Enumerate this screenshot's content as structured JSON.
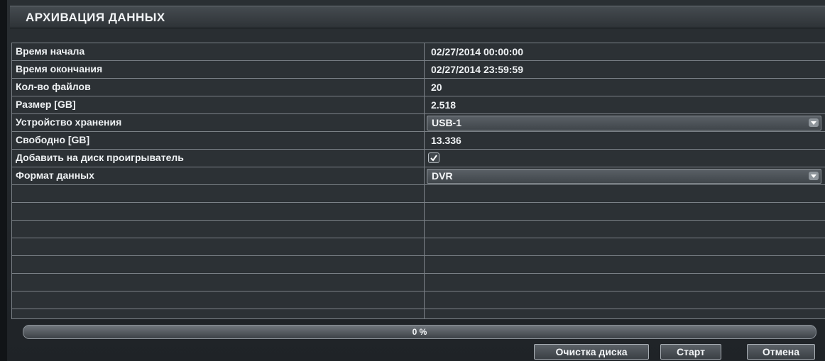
{
  "window": {
    "title": "АРХИВАЦИЯ ДАННЫХ"
  },
  "fields": {
    "start_time": {
      "label": "Время начала",
      "value": "02/27/2014 00:00:00"
    },
    "end_time": {
      "label": "Время окончания",
      "value": "02/27/2014 23:59:59"
    },
    "file_count": {
      "label": "Кол-во файлов",
      "value": "20"
    },
    "size": {
      "label": "Размер [GB]",
      "value": "2.518"
    },
    "storage_device": {
      "label": "Устройство хранения",
      "selected": "USB-1"
    },
    "free": {
      "label": "Свободно [GB]",
      "value": "13.336"
    },
    "add_player": {
      "label": "Добавить на диск проигрыватель",
      "checked": true
    },
    "data_format": {
      "label": "Формат данных",
      "selected": "DVR"
    }
  },
  "progress": {
    "percent": 0,
    "text": "0 %"
  },
  "buttons": {
    "clear_disk": "Очистка диска",
    "start": "Старт",
    "cancel": "Отмена"
  },
  "colors": {
    "background": "#1f2327",
    "grid_line": "#7b8187",
    "text": "#eef1f3",
    "progress_fill": "#4f9bd1"
  },
  "icons": {
    "dropdown": "chevron-down-icon",
    "checkbox": "checkmark-icon"
  }
}
